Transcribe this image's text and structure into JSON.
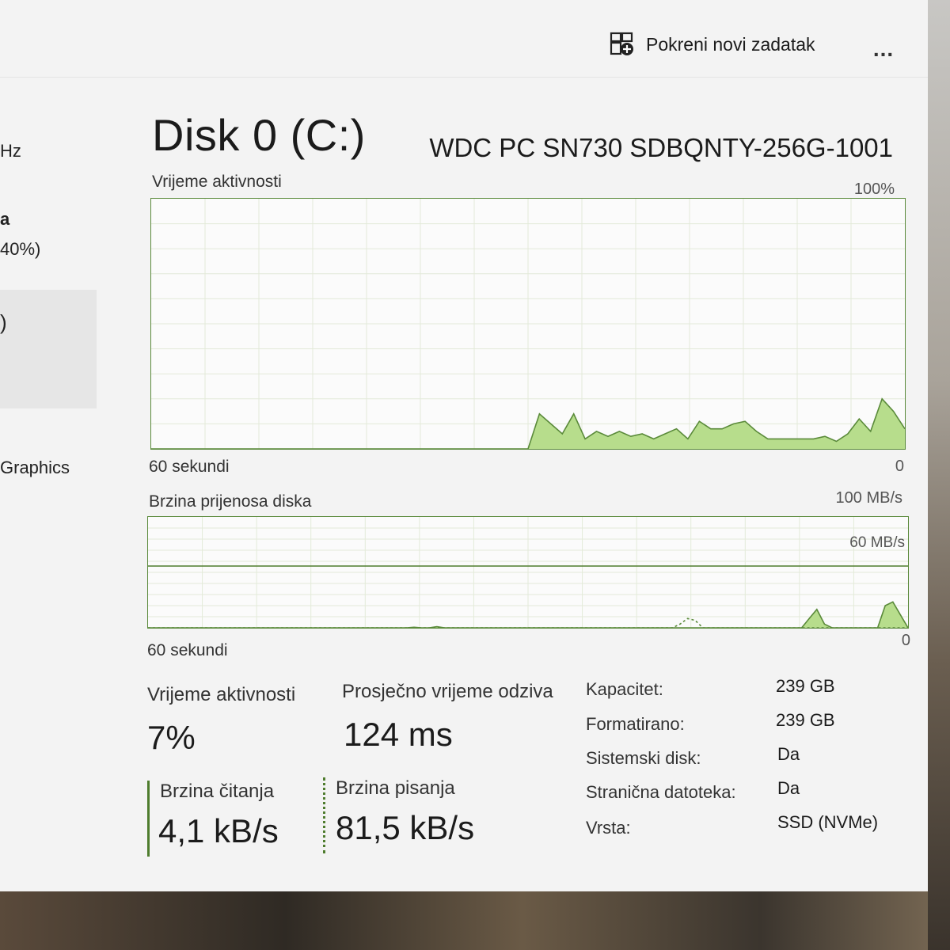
{
  "toolbar": {
    "new_task_label": "Pokreni novi zadatak",
    "more_label": "..."
  },
  "sidebar": {
    "items": [
      "Hz",
      "a",
      "40%)",
      ")",
      "Graphics"
    ]
  },
  "disk": {
    "title": "Disk 0 (C:)",
    "model": "WDC PC SN730 SDBQNTY-256G-1001"
  },
  "activity_graph": {
    "label": "Vrijeme aktivnosti",
    "max_label": "100%",
    "time_label": "60 sekundi",
    "min_label": "0",
    "samples": [
      0,
      0,
      0,
      0,
      0,
      0,
      0,
      0,
      0,
      0,
      0,
      0,
      0,
      0,
      0,
      0,
      0,
      0,
      0,
      0,
      0,
      0,
      0,
      0,
      0,
      0,
      0,
      0,
      0,
      0,
      0,
      0,
      0,
      0,
      14,
      10,
      6,
      14,
      4,
      7,
      5,
      7,
      5,
      6,
      4,
      6,
      8,
      4,
      11,
      8,
      8,
      10,
      11,
      7,
      4,
      4,
      4,
      4,
      4,
      5,
      3,
      6,
      12,
      7,
      20,
      15,
      8
    ]
  },
  "transfer_graph": {
    "label": "Brzina prijenosa diska",
    "max_label": "100 MB/s",
    "scale_label": "60 MB/s",
    "time_label": "60 sekundi",
    "min_label": "0",
    "write_samples": [
      0,
      0,
      0,
      0,
      0,
      0,
      0,
      0,
      0,
      0,
      0,
      0,
      0,
      0,
      0,
      0,
      0,
      0,
      0,
      0,
      0,
      0,
      0,
      0,
      0,
      0,
      0,
      0,
      0,
      0,
      0,
      0,
      0,
      0,
      0,
      0.3,
      0,
      0,
      0.6,
      0,
      0,
      0,
      0,
      0,
      0,
      0,
      0,
      0,
      0,
      0,
      0,
      0,
      0,
      0,
      0,
      0,
      0,
      0,
      0,
      0,
      0,
      0,
      0,
      0,
      0,
      0,
      0,
      0,
      0,
      0,
      0,
      0,
      0,
      0,
      0,
      0,
      0,
      0,
      0,
      0,
      0,
      0,
      0,
      0,
      0,
      0,
      0,
      5,
      10,
      2,
      0,
      0,
      0,
      0,
      0,
      0,
      0,
      12,
      14,
      7,
      0
    ],
    "read_samples": [
      0,
      0,
      0,
      0,
      0,
      0,
      0,
      0,
      0,
      0,
      0,
      0,
      0,
      0,
      0,
      0,
      0,
      0,
      0,
      0,
      0,
      0,
      0,
      0,
      0,
      0,
      0,
      0,
      0,
      0,
      0,
      0,
      0,
      0,
      0,
      0,
      0,
      0,
      0,
      0,
      0,
      0,
      0,
      0,
      0,
      0,
      0,
      0,
      0,
      0,
      0,
      0,
      0,
      0,
      0,
      0,
      0,
      0,
      0,
      0,
      0,
      0,
      0,
      0,
      0,
      0,
      0,
      0,
      0,
      0,
      2,
      5,
      4,
      0,
      0,
      0,
      0,
      0,
      0,
      0,
      0,
      0,
      0,
      0,
      0,
      0,
      0,
      0,
      0,
      0,
      0,
      0,
      0,
      0,
      0,
      0,
      0,
      0,
      0,
      0,
      0
    ]
  },
  "stats": {
    "active_time_label": "Vrijeme aktivnosti",
    "active_time_value": "7%",
    "response_label": "Prosječno vrijeme odziva",
    "response_value": "124 ms",
    "read_label": "Brzina čitanja",
    "read_value": "4,1 kB/s",
    "write_label": "Brzina pisanja",
    "write_value": "81,5 kB/s"
  },
  "properties": [
    {
      "key": "Kapacitet:",
      "value": "239 GB"
    },
    {
      "key": "Formatirano:",
      "value": "239 GB"
    },
    {
      "key": "Sistemski disk:",
      "value": "Da"
    },
    {
      "key": "Stranična datoteka:",
      "value": "Da"
    },
    {
      "key": "Vrsta:",
      "value": "SSD (NVMe)"
    }
  ],
  "colors": {
    "graph_line": "#5a8a3a",
    "graph_fill": "#b7dd8c",
    "grid": "#e3ead9"
  }
}
